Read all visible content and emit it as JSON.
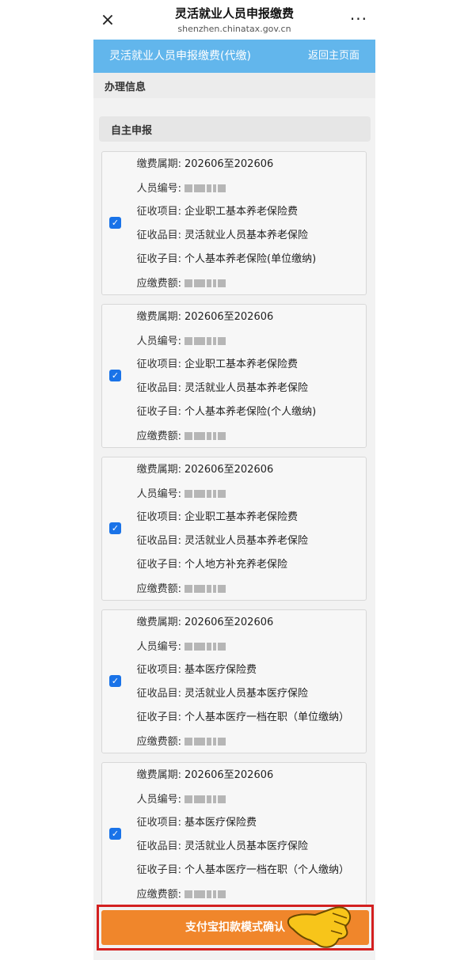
{
  "topbar": {
    "title": "灵活就业人员申报缴费",
    "url": "shenzhen.chinatax.gov.cn",
    "close_icon": "×",
    "more_icon": "···"
  },
  "bluebar": {
    "title": "灵活就业人员申报缴费(代缴)",
    "home_link": "返回主页面",
    "color": "#62b6ec"
  },
  "section": {
    "title": "办理信息"
  },
  "subsection": {
    "title": "自主申报"
  },
  "labels": {
    "period": "缴费属期:",
    "person_no": "人员编号:",
    "item": "征收项目:",
    "category": "征收品目:",
    "subitem": "征收子目:",
    "amount": "应缴费额:"
  },
  "records": [
    {
      "checked": true,
      "period": "202606至202606",
      "item": "企业职工基本养老保险费",
      "category": "灵活就业人员基本养老保险",
      "subitem": "个人基本养老保险(单位缴纳)"
    },
    {
      "checked": true,
      "period": "202606至202606",
      "item": "企业职工基本养老保险费",
      "category": "灵活就业人员基本养老保险",
      "subitem": "个人基本养老保险(个人缴纳)"
    },
    {
      "checked": true,
      "period": "202606至202606",
      "item": "企业职工基本养老保险费",
      "category": "灵活就业人员基本养老保险",
      "subitem": "个人地方补充养老保险"
    },
    {
      "checked": true,
      "period": "202606至202606",
      "item": "基本医疗保险费",
      "category": "灵活就业人员基本医疗保险",
      "subitem": "个人基本医疗一档在职（单位缴纳）"
    },
    {
      "checked": true,
      "period": "202606至202606",
      "item": "基本医疗保险费",
      "category": "灵活就业人员基本医疗保险",
      "subitem": "个人基本医疗一档在职（个人缴纳）"
    }
  ],
  "checkbox_mark": "✓",
  "pay_button": {
    "label": "支付宝扣款模式确认",
    "color": "#f0862b",
    "highlight_color": "#d32020"
  },
  "hand_icon": "pointing-hand-icon"
}
